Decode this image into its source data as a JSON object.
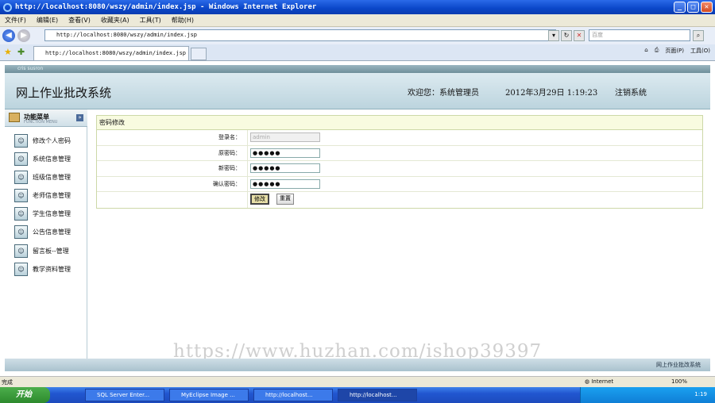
{
  "window": {
    "title": "http://localhost:8080/wszy/admin/index.jsp - Windows Internet Explorer"
  },
  "menu": {
    "items": [
      "文件(F)",
      "编辑(E)",
      "查看(V)",
      "收藏夹(A)",
      "工具(T)",
      "帮助(H)"
    ]
  },
  "address": {
    "url": "http://localhost:8080/wszy/admin/index.jsp",
    "search_placeholder": "百度"
  },
  "tabs": [
    {
      "label": "http://localhost:8080/wszy/admin/index.jsp"
    }
  ],
  "toolbar_tools": {
    "page": "页面(P)",
    "tools": "工具(O)"
  },
  "app": {
    "strip_text": "cris susron",
    "title": "网上作业批改系统",
    "welcome": "欢迎您：系统管理员",
    "datetime": "2012年3月29日  1:19:23",
    "logout": "注销系统"
  },
  "sidebar": {
    "title": "功能菜单",
    "subtitle": "FUNCTION MENU",
    "items": [
      {
        "label": "修改个人密码"
      },
      {
        "label": "系统信息管理"
      },
      {
        "label": "班级信息管理"
      },
      {
        "label": "老师信息管理"
      },
      {
        "label": "学生信息管理"
      },
      {
        "label": "公告信息管理"
      },
      {
        "label": "留言板--管理"
      },
      {
        "label": "教学资料管理"
      }
    ]
  },
  "form": {
    "heading": "密码修改",
    "username_label": "登录名：",
    "username_value": "admin",
    "old_pwd_label": "原密码：",
    "old_pwd_value": "●●●●●",
    "new_pwd_label": "新密码：",
    "new_pwd_value": "●●●●●",
    "confirm_pwd_label": "确认密码：",
    "confirm_pwd_value": "●●●●●",
    "submit_label": "修改",
    "reset_label": "重置"
  },
  "watermark": "https://www.huzhan.com/ishop39397",
  "app_footer": "网上作业批改系统",
  "status": {
    "left": "完成",
    "zone": "Internet",
    "zoom": "100%"
  },
  "taskbar": {
    "start": "开始",
    "tasks": [
      {
        "label": "SQL Server Enter..."
      },
      {
        "label": "MyEclipse Image ..."
      },
      {
        "label": "http://localhost..."
      },
      {
        "label": "http://localhost..."
      }
    ],
    "clock": "1:19"
  }
}
